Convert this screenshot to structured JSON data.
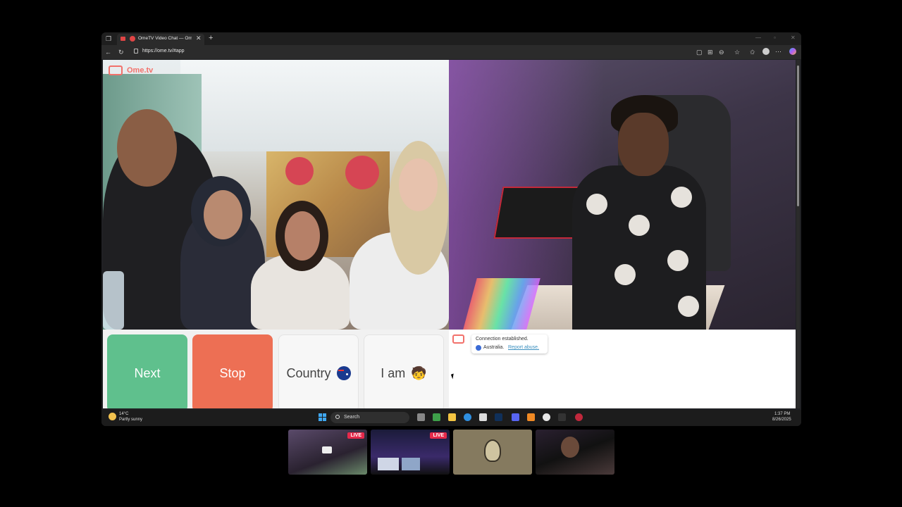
{
  "browser": {
    "tab_title": "OmeTV Video Chat — Ome…",
    "url": "https://ome.tv/#app",
    "new_tab_glyph": "+",
    "tab_close_glyph": "✕"
  },
  "site": {
    "logo_text": "Ome.tv"
  },
  "controls": {
    "next_label": "Next",
    "stop_label": "Stop",
    "country_label": "Country",
    "iam_label": "I am",
    "iam_emoji": "🧒"
  },
  "chat": {
    "status": "Connection established.",
    "country": "Australia.",
    "report_link": "Report abuse."
  },
  "taskbar": {
    "weather_temp": "14°C",
    "weather_desc": "Partly sunny",
    "search_label": "Search",
    "time": "1:37 PM",
    "date": "8/26/2025"
  },
  "thumbnails": [
    {
      "live_badge": "LIVE"
    },
    {
      "live_badge": "LIVE"
    },
    {
      "live_badge": ""
    },
    {
      "live_badge": ""
    }
  ],
  "colors": {
    "next": "#5fc08d",
    "stop": "#ed6f54",
    "brand": "#f2716b",
    "live": "#e6294b"
  }
}
